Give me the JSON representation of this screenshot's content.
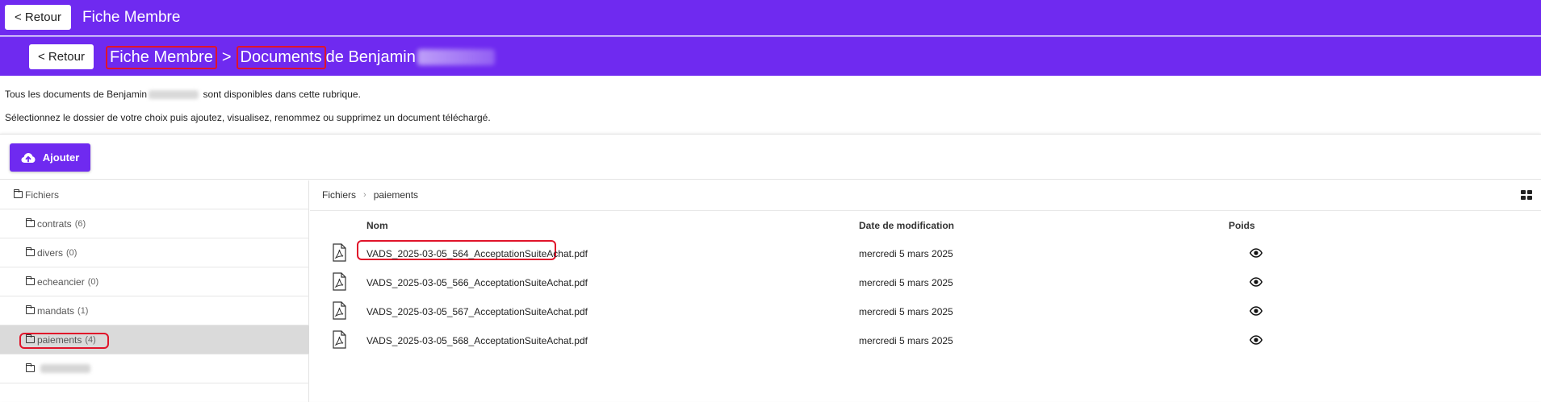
{
  "header": {
    "back_label": "< Retour",
    "title": "Fiche Membre"
  },
  "subheader": {
    "back_label": "< Retour",
    "crumb_member": "Fiche Membre",
    "separator": ">",
    "crumb_documents": "Documents",
    "crumb_suffix": " de Benjamin"
  },
  "intro": {
    "line1_prefix": "Tous les documents de Benjamin",
    "line1_suffix": " sont disponibles dans cette rubrique.",
    "line2": "Sélectionnez le dossier de votre choix puis ajoutez, visualisez, renommez ou supprimez un document téléchargé."
  },
  "toolbar": {
    "add_label": "Ajouter",
    "add_icon": "cloud-upload-icon"
  },
  "tree": {
    "root_label": "Fichiers",
    "folders": [
      {
        "name": "contrats",
        "count": "(6)"
      },
      {
        "name": "divers",
        "count": "(0)"
      },
      {
        "name": "echeancier",
        "count": "(0)"
      },
      {
        "name": "mandats",
        "count": "(1)"
      },
      {
        "name": "paiements",
        "count": "(4)"
      }
    ],
    "active_folder": "paiements"
  },
  "files": {
    "breadcrumb_root": "Fichiers",
    "breadcrumb_current": "paiements",
    "columns": {
      "name": "Nom",
      "date": "Date de modification",
      "size": "Poids"
    },
    "rows": [
      {
        "name": "VADS_2025-03-05_564_AcceptationSuiteAchat.pdf",
        "date": "mercredi 5 mars 2025",
        "size": ""
      },
      {
        "name": "VADS_2025-03-05_566_AcceptationSuiteAchat.pdf",
        "date": "mercredi 5 mars 2025",
        "size": ""
      },
      {
        "name": "VADS_2025-03-05_567_AcceptationSuiteAchat.pdf",
        "date": "mercredi 5 mars 2025",
        "size": ""
      },
      {
        "name": "VADS_2025-03-05_568_AcceptationSuiteAchat.pdf",
        "date": "mercredi 5 mars 2025",
        "size": ""
      }
    ]
  },
  "colors": {
    "brand": "#6f2af0",
    "highlight": "#e0142a",
    "active_row": "#dadada"
  }
}
